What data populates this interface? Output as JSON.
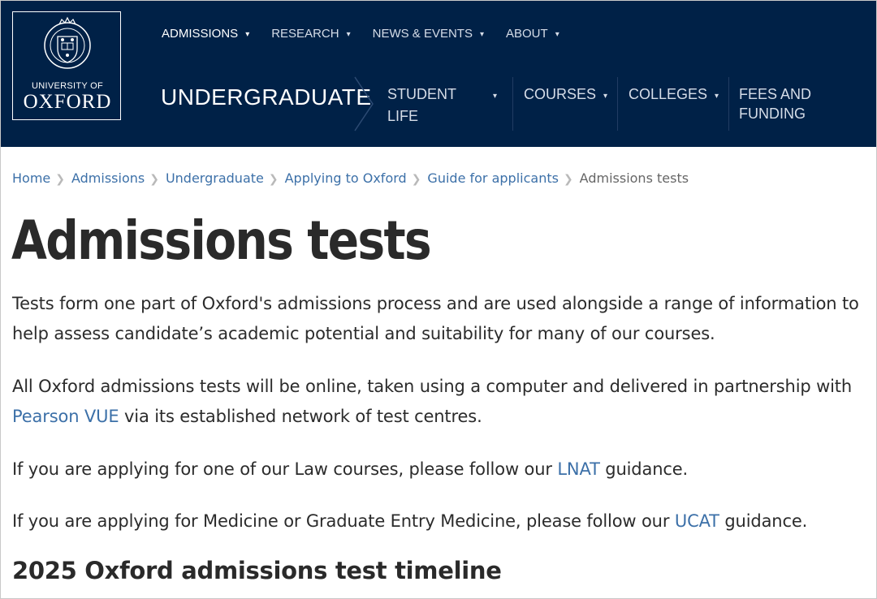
{
  "header": {
    "logo": {
      "line1": "UNIVERSITY OF",
      "line2": "OXFORD",
      "crest_motto": "UNIVERSITY OF OXFORD"
    },
    "top_nav": [
      {
        "label": "ADMISSIONS"
      },
      {
        "label": "RESEARCH"
      },
      {
        "label": "NEWS & EVENTS"
      },
      {
        "label": "ABOUT"
      }
    ],
    "section_title": "UNDERGRADUATE",
    "sub_nav": [
      {
        "line1": "STUDENT",
        "line2": "LIFE"
      },
      {
        "line1": "COURSES",
        "line2": ""
      },
      {
        "line1": "COLLEGES",
        "line2": ""
      },
      {
        "line1": "FEES AND",
        "line2": "FUNDING"
      }
    ],
    "colors": {
      "navy": "#002147",
      "link": "#3c70a8"
    }
  },
  "breadcrumb": {
    "items": [
      "Home",
      "Admissions",
      "Undergraduate",
      "Applying to Oxford",
      "Guide for applicants"
    ],
    "current": "Admissions tests",
    "separator": "❯"
  },
  "page_title": "Admissions tests",
  "paragraphs": {
    "p1": "Tests form one part of Oxford's admissions process and are used alongside a range of information to help assess candidate’s academic potential and suitability for many of our courses.",
    "p2_before": "All Oxford admissions tests will be online, taken using a computer and delivered in partnership with ",
    "p2_link": "Pearson VUE",
    "p2_after": " via its established network of test centres.",
    "p3_before": "If you are applying for one of our Law courses, please follow our ",
    "p3_link": "LNAT",
    "p3_after": " guidance.",
    "p4_before": "If you are applying for Medicine or Graduate Entry Medicine, please follow our ",
    "p4_link": "UCAT",
    "p4_after": " guidance."
  },
  "section_heading": "2025 Oxford admissions test timeline",
  "icons": {
    "caret": "▾",
    "crest": "oxford-crest-icon",
    "chevron": "chevron-right-icon"
  }
}
